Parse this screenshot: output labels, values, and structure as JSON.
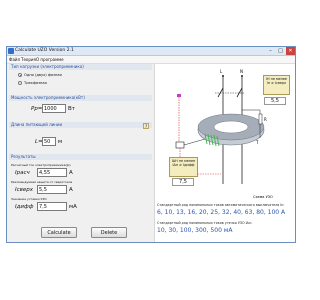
{
  "window": {
    "title": "Calculate UZO Version 2.1",
    "minimize": "–",
    "maximize": "□",
    "close": "✕"
  },
  "menu": [
    "Файл",
    "Теория",
    "О программе"
  ],
  "load_type": {
    "heading": "Тип нагрузки (электроприемника)",
    "options": [
      "Одно (двух) фазная",
      "Трехфазная"
    ],
    "selected": 0
  },
  "power": {
    "heading": "Мощность электроприемника(кВт)",
    "label": "Pр=",
    "value": "1000",
    "unit": "Вт"
  },
  "line_length": {
    "heading": "Длина питающей линии",
    "label": "L=",
    "value": "50",
    "unit": "м",
    "help": "?"
  },
  "results": {
    "heading": "Результаты",
    "current_label": "Расчетный ток электроприемника(Ip)",
    "current_symbol": "Iрасч",
    "current_value": "4,55",
    "current_unit": "А",
    "rated_label": "Рекомендуемая защита от сверхтоков",
    "rated_symbol": "Iсверх",
    "rated_value": "5,5",
    "rated_unit": "А",
    "leak_label": "Значение уставки УЗО",
    "leak_symbol": "Iдифф",
    "leak_value": "7,5",
    "leak_unit": "мА"
  },
  "buttons": {
    "calculate": "Calculate",
    "delete": "Delete"
  },
  "diagram": {
    "labels": {
      "L": "L",
      "N": "N",
      "R": "R",
      "T": "T",
      "caption": "Схема УЗО"
    },
    "note_top": {
      "line1": "IН не менее",
      "line2": "Iн ≥ Iсверх",
      "value": "5,5"
    },
    "note_bottom": {
      "line1": "IΔН не менее",
      "line2": "IΔн ≥ Iдифф",
      "value": "7,5"
    }
  },
  "standard_currents": {
    "label": "Стандартный ряд номинальных токов автоматического выключателя In:",
    "values": "6, 10, 13, 16, 20, 25, 32, 40, 63, 80, 100 А"
  },
  "standard_leak": {
    "label": "Стандартный ряд номинальных токов утечки УЗО IΔn:",
    "values": "10, 30, 100, 300, 500 мА"
  },
  "colors": {
    "accent": "#1e5bb8",
    "note_fill": "#f4edbf",
    "coil_green": "#3bb54a",
    "toroid": "#9aa2ad",
    "wire": "#222222",
    "red_line": "#d23030"
  }
}
